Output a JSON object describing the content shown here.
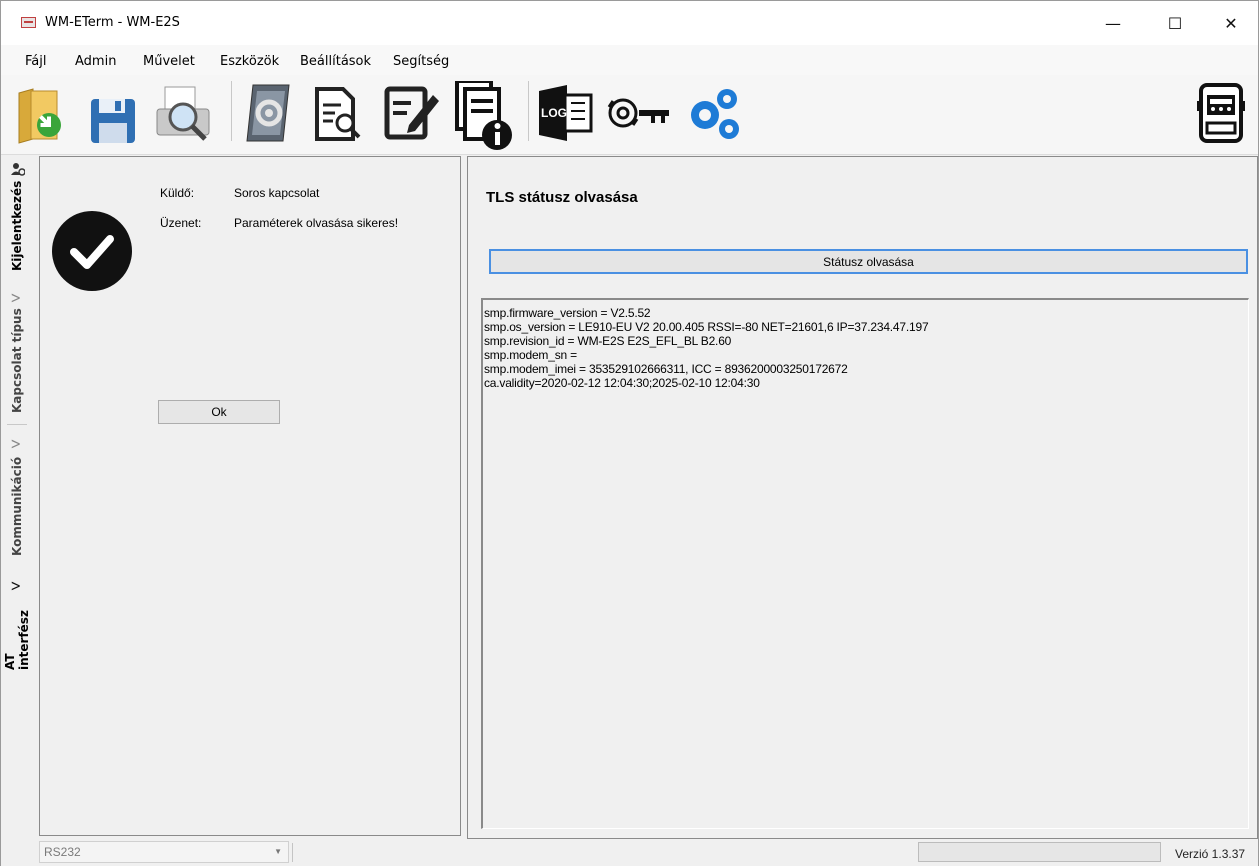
{
  "window": {
    "title": "WM-ETerm - WM-E2S",
    "minimize": "—",
    "maximize": "☐",
    "close": "✕"
  },
  "menu": [
    "Fájl",
    "Admin",
    "Művelet",
    "Eszközök",
    "Beállítások",
    "Segítség"
  ],
  "toolbar": {
    "icons": [
      "open-folder-icon",
      "save-disk-icon",
      "print-preview-icon",
      "settings-book-icon",
      "document-search-icon",
      "edit-document-icon",
      "document-info-icon",
      "log-icon",
      "key-sync-icon",
      "gears-icon",
      "meter-icon"
    ],
    "log_text": "LOG"
  },
  "side_tabs": [
    "Kijelentkezés",
    "Kapcsolat típus",
    "Kommunikáció",
    "AT interfész"
  ],
  "message": {
    "sender_label": "Küldő:",
    "sender": "Soros kapcsolat",
    "message_label": "Üzenet:",
    "message": "Paraméterek olvasása sikeres!",
    "ok": "Ok"
  },
  "tls": {
    "title": "TLS státusz olvasása",
    "read_button": "Státusz olvasása",
    "output": [
      "smp.firmware_version = V2.5.52",
      "smp.os_version = LE910-EU V2 20.00.405 RSSI=-80 NET=21601,6 IP=37.234.47.197",
      "smp.revision_id = WM-E2S E2S_EFL_BL B2.60",
      "smp.modem_sn =",
      "smp.modem_imei = 353529102666311, ICC = 8936200003250172672",
      "ca.validity=2020-02-12 12:04:30;2025-02-10 12:04:30"
    ]
  },
  "status": {
    "port": "RS232",
    "version": "Verzió 1.3.37"
  }
}
